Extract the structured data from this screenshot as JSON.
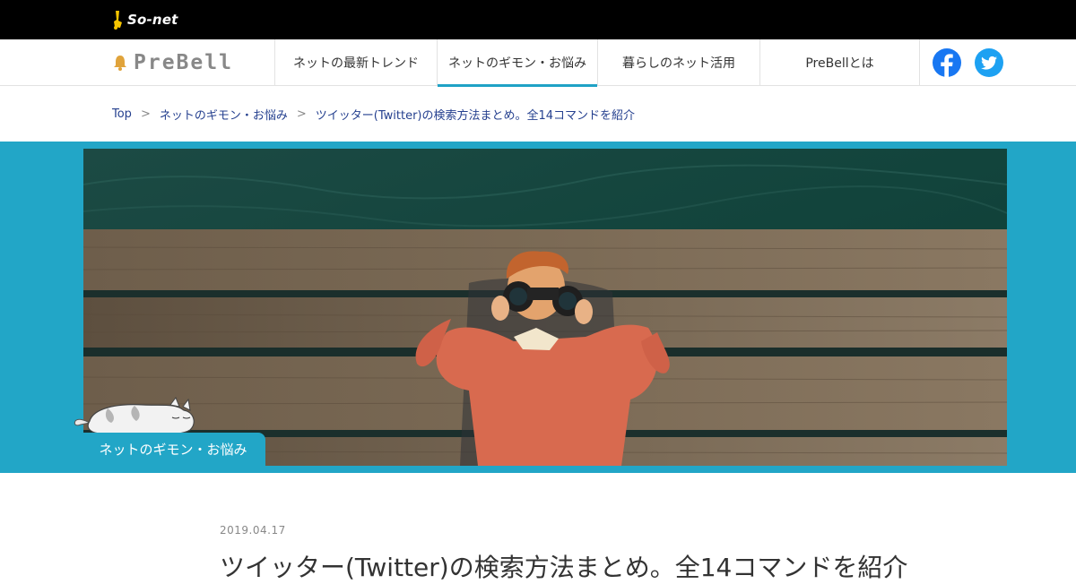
{
  "header": {
    "brand": "So-net"
  },
  "nav": {
    "logo_text": "PreBell",
    "items": [
      {
        "label": "ネットの最新トレンド"
      },
      {
        "label": "ネットのギモン・お悩み"
      },
      {
        "label": "暮らしのネット活用"
      },
      {
        "label": "PreBellとは"
      }
    ],
    "active_index": 1,
    "accent_color": "#1fa2c6",
    "social": [
      {
        "icon": "facebook-icon",
        "color": "#1877f2"
      },
      {
        "icon": "twitter-icon",
        "color": "#1da1f2"
      }
    ]
  },
  "breadcrumb": {
    "items": [
      {
        "label": "Top"
      },
      {
        "label": "ネットのギモン・お悩み"
      },
      {
        "label": "ツイッター(Twitter)の検索方法まとめ。全14コマンドを紹介"
      }
    ],
    "separator": ">"
  },
  "hero": {
    "band_color": "#22a6c7",
    "category_label": "ネットのギモン・お悩み"
  },
  "article": {
    "date": "2019.04.17",
    "title": "ツイッター(Twitter)の検索方法まとめ。全14コマンドを紹介"
  }
}
